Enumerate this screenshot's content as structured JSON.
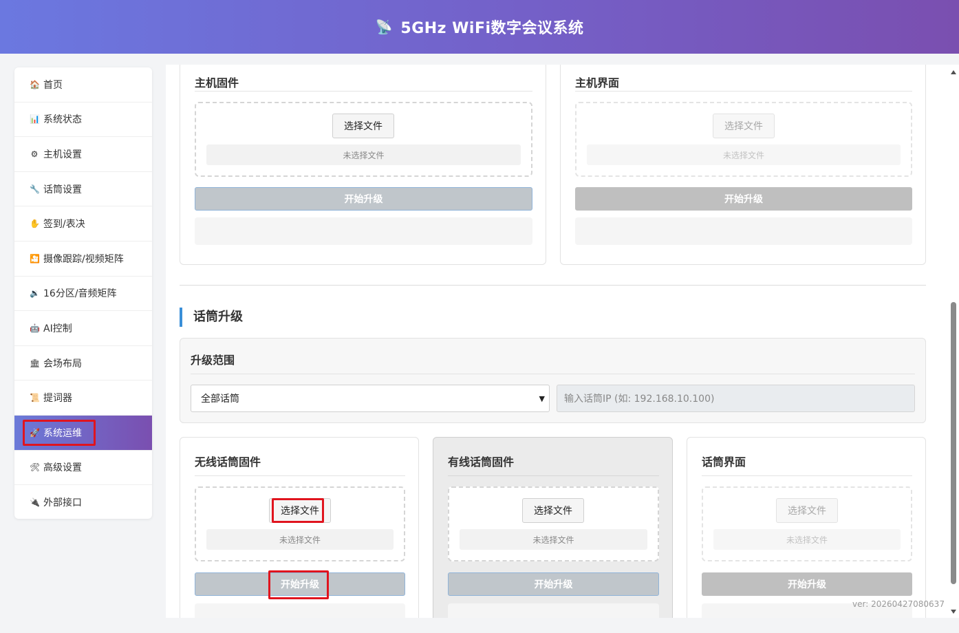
{
  "header": {
    "logo_icon": "satellite-dish-icon",
    "title": "5GHz WiFi数字会议系统"
  },
  "sidebar": {
    "items": [
      {
        "icon": "🏠",
        "label": "首页"
      },
      {
        "icon": "📊",
        "label": "系统状态"
      },
      {
        "icon": "⚙",
        "label": "主机设置"
      },
      {
        "icon": "🔧",
        "label": "话筒设置"
      },
      {
        "icon": "✋",
        "label": "签到/表决"
      },
      {
        "icon": "🎦",
        "label": "摄像跟踪/视频矩阵"
      },
      {
        "icon": "🔉",
        "label": "16分区/音频矩阵"
      },
      {
        "icon": "🤖",
        "label": "AI控制"
      },
      {
        "icon": "🏛",
        "label": "会场布局"
      },
      {
        "icon": "📜",
        "label": "提词器"
      },
      {
        "icon": "🚀",
        "label": "系统运维"
      },
      {
        "icon": "🛠",
        "label": "高级设置"
      },
      {
        "icon": "🔌",
        "label": "外部接口"
      }
    ],
    "active_index": 10
  },
  "host": {
    "firmware": {
      "title": "主机固件",
      "choose": "选择文件",
      "no_file": "未选择文件",
      "upgrade": "开始升级"
    },
    "ui": {
      "title": "主机界面",
      "choose": "选择文件",
      "no_file": "未选择文件",
      "upgrade": "开始升级"
    }
  },
  "mic": {
    "section_title": "话筒升级",
    "scope": {
      "title": "升级范围",
      "selected": "全部话筒",
      "ip_placeholder": "输入话筒IP (如: 192.168.10.100)"
    },
    "wireless": {
      "title": "无线话筒固件",
      "choose": "选择文件",
      "no_file": "未选择文件",
      "upgrade": "开始升级"
    },
    "wired": {
      "title": "有线话筒固件",
      "choose": "选择文件",
      "no_file": "未选择文件",
      "upgrade": "开始升级"
    },
    "ui": {
      "title": "话筒界面",
      "choose": "选择文件",
      "no_file": "未选择文件",
      "upgrade": "开始升级"
    }
  },
  "version": "ver: 20260427080637"
}
